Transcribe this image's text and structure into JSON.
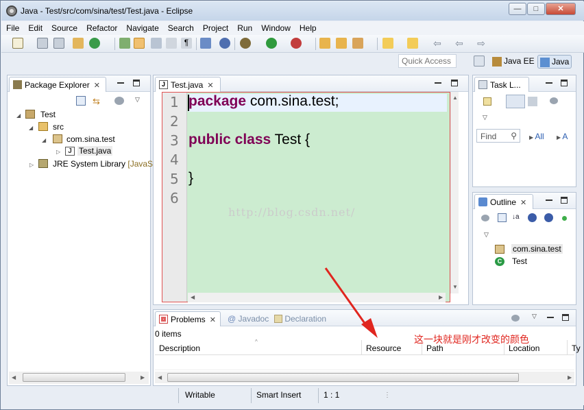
{
  "window": {
    "title": "Java - Test/src/com/sina/test/Test.java - Eclipse"
  },
  "menu": [
    "File",
    "Edit",
    "Source",
    "Refactor",
    "Navigate",
    "Search",
    "Project",
    "Run",
    "Window",
    "Help"
  ],
  "quick_access": {
    "placeholder": "Quick Access"
  },
  "perspectives": {
    "java_ee": "Java EE",
    "java": "Java"
  },
  "package_explorer": {
    "title": "Package Explorer",
    "tree": {
      "project": "Test",
      "src": "src",
      "package": "com.sina.test",
      "file": "Test.java",
      "jre": "JRE System Library",
      "jre_suffix": "[JavaSE"
    }
  },
  "editor": {
    "tab": "Test.java",
    "lines": [
      {
        "num": "1",
        "kw": "package",
        "rest": " com.sina.test;"
      },
      {
        "num": "2",
        "kw": "",
        "rest": ""
      },
      {
        "num": "3",
        "kw": "public class",
        "rest": " Test {"
      },
      {
        "num": "4",
        "kw": "",
        "rest": ""
      },
      {
        "num": "5",
        "kw": "",
        "rest": "}"
      },
      {
        "num": "6",
        "kw": "",
        "rest": ""
      }
    ],
    "watermark": "http://blog.csdn.net/"
  },
  "task_list": {
    "title": "Task L...",
    "find_placeholder": "Find",
    "all": "All",
    "a": "A"
  },
  "outline": {
    "title": "Outline",
    "items": [
      "com.sina.test",
      "Test"
    ]
  },
  "problems": {
    "tabs": [
      "Problems",
      "Javadoc",
      "Declaration"
    ],
    "count": "0 items",
    "columns": [
      "Description",
      "Resource",
      "Path",
      "Location",
      "Ty"
    ]
  },
  "status": {
    "writable": "Writable",
    "insert": "Smart Insert",
    "position": "1 : 1"
  },
  "annotation": "这一块就是刚才改变的颜色",
  "colors": {
    "editor_bg": "#ccecd0",
    "keyword": "#7f0055",
    "annotation": "#e0261f"
  }
}
